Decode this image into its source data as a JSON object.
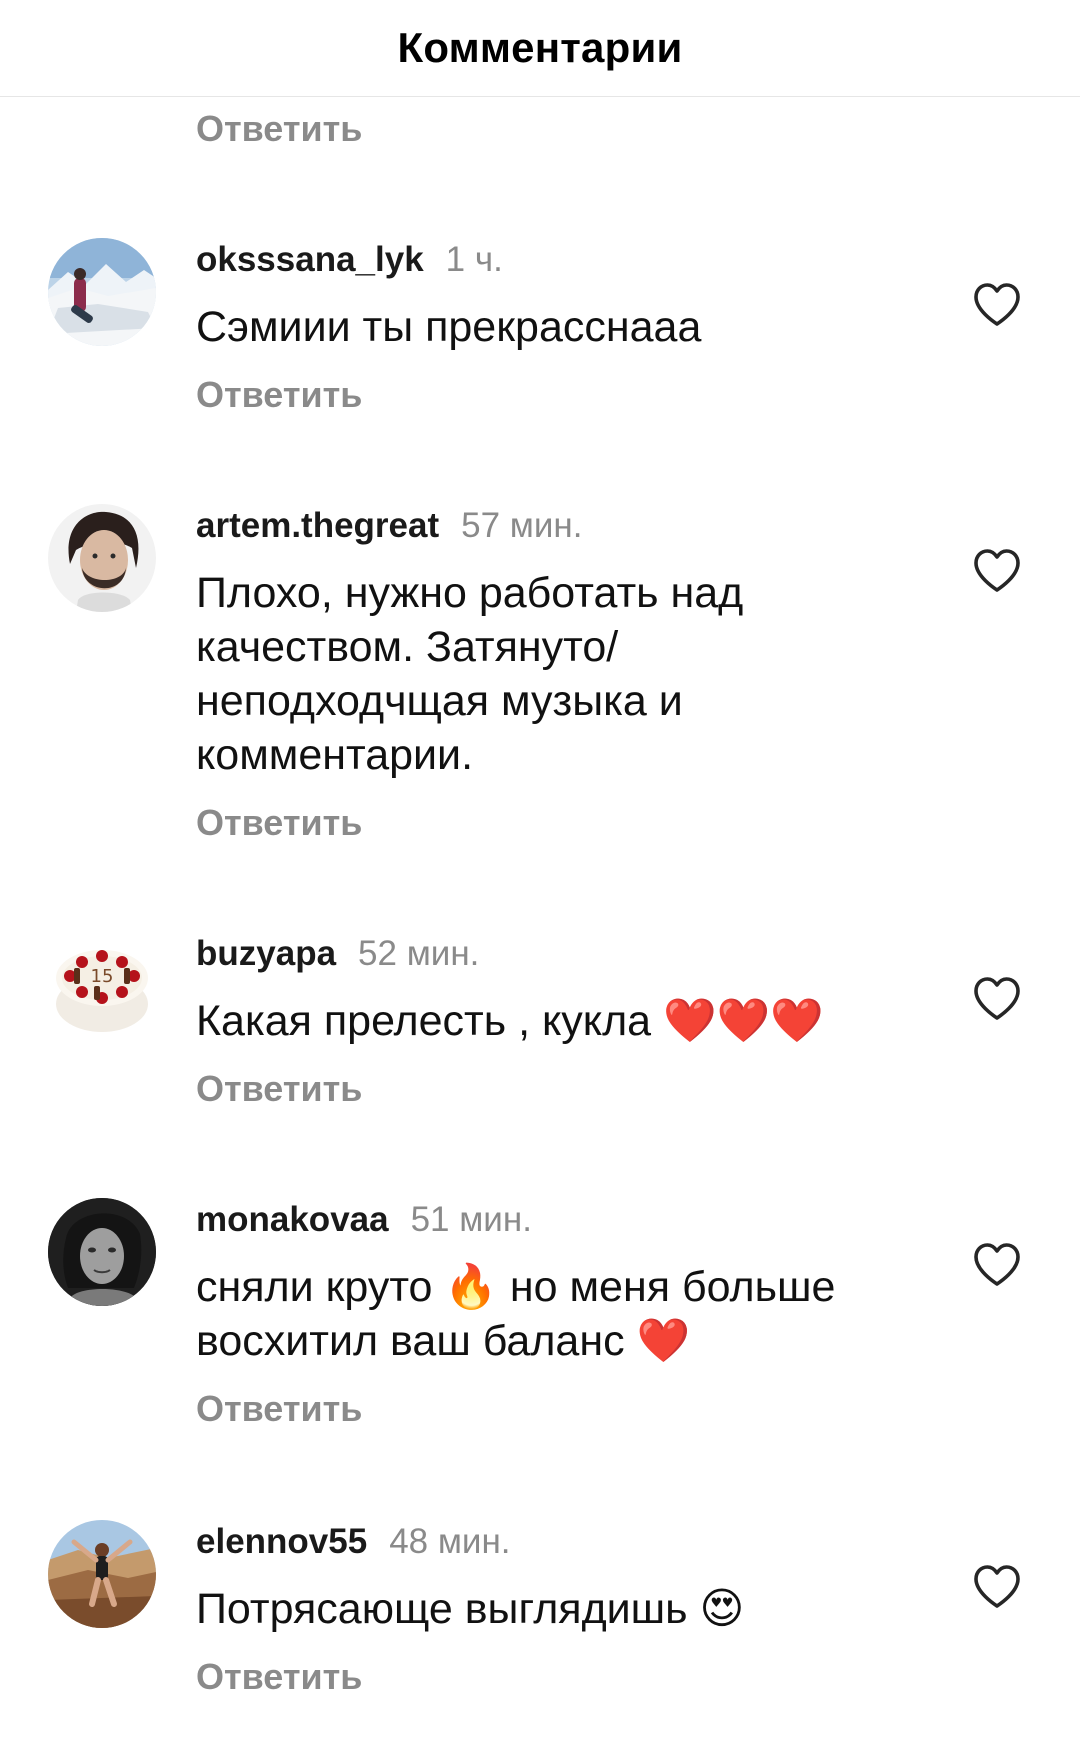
{
  "header": {
    "title": "Комментарии"
  },
  "top_reply_label": "Ответить",
  "comments": [
    {
      "username": "oksssana_lyk",
      "time": "1 ч.",
      "text": "Сэмиии ты прекрасснаaa",
      "reply_label": "Ответить",
      "avatar": "snowboarder-avatar"
    },
    {
      "username": "artem.thegreat",
      "time": "57 мин.",
      "text": "Плохо, нужно работать над качеством. Затянуто/ неподходчщая музыка и комментарии.",
      "reply_label": "Ответить",
      "avatar": "bearded-man-avatar"
    },
    {
      "username": "buzyapa",
      "time": "52 мин.",
      "text": "Какая прелесть , кукла ❤️❤️❤️",
      "reply_label": "Ответить",
      "avatar": "cake-avatar"
    },
    {
      "username": "monakovaa",
      "time": "51 мин.",
      "text": "сняли круто 🔥 но меня больше восхитил ваш баланс ❤️",
      "reply_label": "Ответить",
      "avatar": "woman-bw-avatar"
    },
    {
      "username": "elennov55",
      "time": "48 мин.",
      "text": "Потрясающе выглядишь 😍",
      "reply_label": "Ответить",
      "avatar": "canyon-avatar"
    }
  ],
  "icons": {
    "like": "heart-outline-icon"
  }
}
